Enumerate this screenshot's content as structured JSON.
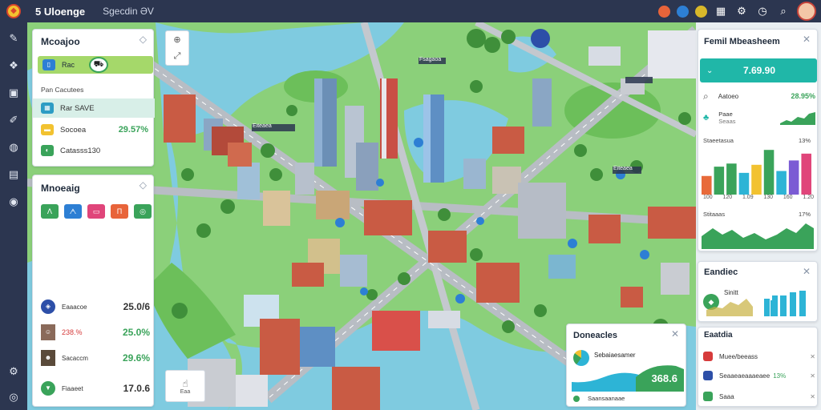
{
  "app": {
    "title": "5 Uloenge",
    "subtitle": "Sgecdin ƏV"
  },
  "topbar_right": {
    "avatar": "user-avatar"
  },
  "left_panel_1": {
    "title": "Mcoajoo",
    "progress_label": "Rac",
    "section_label": "Pan Cacutees",
    "items": [
      {
        "label": "Rar SAVE",
        "value": "",
        "color": "#2d9cc4"
      },
      {
        "label": "Socoea",
        "value": "29.57%",
        "color": "#f2c230"
      },
      {
        "label": "Catasss130",
        "value": "",
        "color": "#3aa35a"
      }
    ]
  },
  "left_panel_2": {
    "title": "Mnoeaig",
    "buttons": [
      {
        "label": "ᐱ",
        "color": "#3aa35a"
      },
      {
        "label": "ᗅ",
        "color": "#2d7fd4"
      },
      {
        "label": "▭",
        "color": "#e0457a"
      },
      {
        "label": "Π",
        "color": "#e8643a"
      },
      {
        "label": "◎",
        "color": "#3aa35a"
      }
    ],
    "list": [
      {
        "label": "Eaaacoe",
        "value": "25.0/6",
        "value_color": "#333"
      },
      {
        "label": "238.%",
        "value": "25.0%",
        "value_color": "#3aa35a"
      },
      {
        "label": "Sacaccm",
        "value": "29.6%",
        "value_color": "#3aa35a"
      },
      {
        "label": "Fiaaeet",
        "value": "17.0.6",
        "value_color": "#333"
      }
    ]
  },
  "map_labels": [
    "Eiteaea",
    "Fsagaoa",
    "Eiteaea",
    "Eaa"
  ],
  "right_panel_1": {
    "title": "Femil Mbeasheem",
    "kpi_value": "7.69.90",
    "rows": [
      {
        "label": "Aatoeo",
        "value": "28.95%"
      },
      {
        "label": "Paae",
        "value": "Seaas"
      }
    ],
    "chart_header_left": "Staeetasua",
    "chart_header_right": "13%",
    "chart_data": {
      "type": "bar",
      "categories": [
        "100",
        "120",
        "1.09",
        "130",
        "160",
        "1.20"
      ],
      "values": [
        30,
        45,
        50,
        35,
        48,
        72
      ],
      "colors": [
        "#e86a3a",
        "#3aa35a",
        "#3aa35a",
        "#2db4d6",
        "#f2c230",
        "#3aa35a",
        "#2db4d6",
        "#7b5bd4",
        "#e0457a"
      ]
    },
    "area_label": "Stitaaas",
    "area_right": "17%"
  },
  "right_panel_2": {
    "title": "Eandiec",
    "row_label": "Sinitt"
  },
  "right_panel_3": {
    "title": "Eaatdia",
    "items": [
      {
        "label": "Muee/beeass",
        "value": "",
        "color": "#d63b3b"
      },
      {
        "label": "Seaaeaeaaaeaee",
        "value": "13%",
        "color": "#2d4fa8"
      },
      {
        "label": "Saaa",
        "value": "",
        "color": "#3aa35a"
      }
    ]
  },
  "bottom_panel": {
    "title": "Doneacles",
    "header": "Sebaiaesamer",
    "kpi": "368.6",
    "footer": "Saansaanaae"
  },
  "map_tools": {
    "bottom_label": "Eaa"
  }
}
